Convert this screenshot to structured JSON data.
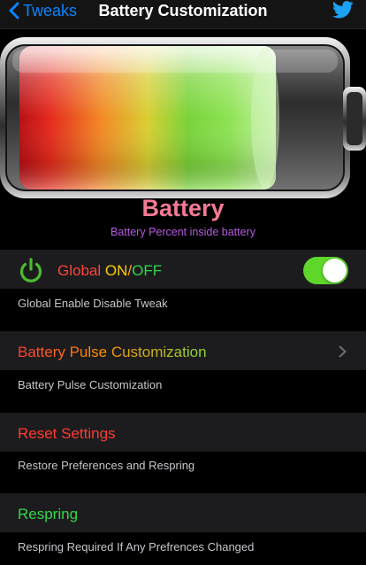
{
  "nav": {
    "back_label": "Tweaks",
    "title": "Battery Customization"
  },
  "header": {
    "title": "Battery",
    "subtitle": "Battery Percent inside battery"
  },
  "global": {
    "label_prefix": "Global ",
    "label_on": "ON",
    "label_slash": "/",
    "label_off": "OFF",
    "toggle_on": true,
    "footer": "Global Enable Disable Tweak"
  },
  "pulse": {
    "label": "Battery Pulse Customization",
    "footer": "Battery Pulse Customization"
  },
  "reset": {
    "label": "Reset Settings",
    "footer": "Restore Preferences and Respring"
  },
  "respring": {
    "label": "Respring",
    "footer": "Respring Required If Any Prefrences Changed"
  },
  "colors": {
    "nav_accent": "#0a84ff",
    "toggle_on": "#5ed62a",
    "reset_red": "#ff3b30",
    "respring_green": "#32d74b",
    "battery_title": "#f47a93",
    "battery_subtitle": "#b65ae0"
  }
}
